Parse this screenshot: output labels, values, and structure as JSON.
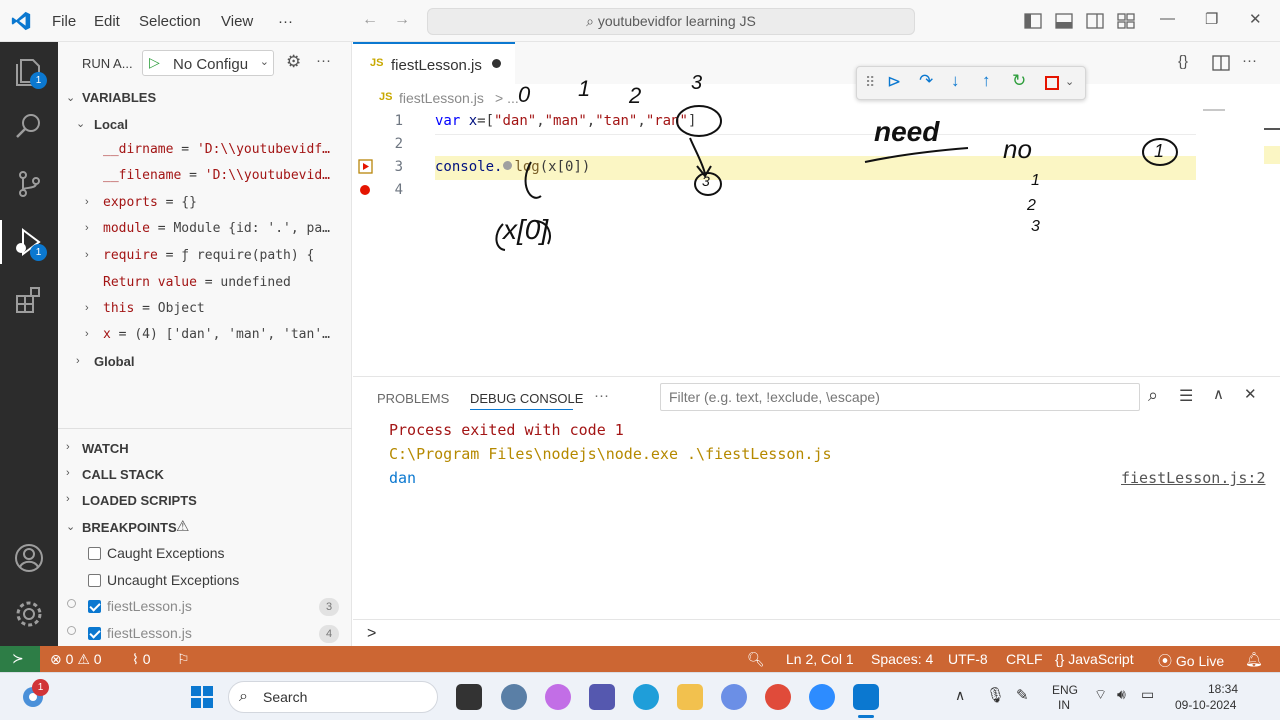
{
  "titlebar": {
    "menu": [
      "File",
      "Edit",
      "Selection",
      "View",
      "···"
    ],
    "search": "youtubevidfor learning JS"
  },
  "activity": {
    "explorer_badge": "1",
    "debug_badge": "1"
  },
  "sidebar": {
    "run_label": "RUN A...",
    "config": "No Configu",
    "variables_title": "VARIABLES",
    "local_title": "Local",
    "vars": [
      {
        "name": "__dirname",
        "value": "'D:\\\\youtubevidf…"
      },
      {
        "name": "__filename",
        "value": "'D:\\\\youtubevid…"
      },
      {
        "name": "exports",
        "value": "{}"
      },
      {
        "name": "module",
        "value": "Module {id: '.', pa…"
      },
      {
        "name": "require",
        "value": "ƒ require(path) {"
      },
      {
        "name": "Return value",
        "value": "undefined"
      },
      {
        "name": "this",
        "value": "Object"
      },
      {
        "name": "x",
        "value": "(4) ['dan', 'man', 'tan'…"
      }
    ],
    "global_title": "Global",
    "watch": "WATCH",
    "callstack": "CALL STACK",
    "loaded": "LOADED SCRIPTS",
    "breakpoints": "BREAKPOINTS",
    "bp_items": [
      {
        "label": "Caught Exceptions",
        "checked": false
      },
      {
        "label": "Uncaught Exceptions",
        "checked": false
      },
      {
        "label": "fiestLesson.js",
        "checked": true,
        "count": "3"
      },
      {
        "label": "fiestLesson.js",
        "checked": true,
        "count": "4"
      }
    ]
  },
  "editor": {
    "tab_name": "fiestLesson.js",
    "breadcrumb_file": "fiestLesson.js",
    "breadcrumb_more": "> ...",
    "lines": [
      "1",
      "2",
      "3",
      "4"
    ],
    "code": {
      "l1_kw": "var",
      "l1_id": "x",
      "l1_eq": "=[",
      "l1_s1": "\"dan\"",
      "l1_s2": "\"man\"",
      "l1_s3": "\"tan\"",
      "l1_s4": "\"ran\"",
      "l1_end": "]",
      "l3_obj": "console.",
      "l3_fn": "log",
      "l3_rest": "(x[0])"
    },
    "annotations": {
      "n0": "0",
      "n1": "1",
      "n2": "2",
      "n3": "3",
      "need": "need",
      "no": "no",
      "circle1": "1",
      "col1": "1",
      "col2": "2",
      "col3": "3",
      "arrow_target": "3",
      "xexpr": "x[0]"
    }
  },
  "panel": {
    "tabs": [
      "PROBLEMS",
      "DEBUG CONSOLE",
      "···"
    ],
    "filter_placeholder": "Filter (e.g. text, !exclude, \\escape)",
    "console": [
      {
        "text": "Process exited with code 1",
        "color": "#a31515"
      },
      {
        "text": "C:\\Program Files\\nodejs\\node.exe .\\fiestLesson.js",
        "color": "#b58900"
      },
      {
        "text": "dan",
        "color": "#0b78d0"
      }
    ],
    "source_link": "fiestLesson.js:2",
    "prompt": ">"
  },
  "status": {
    "errors": "0",
    "warnings": "0",
    "ports": "0",
    "position": "Ln 2, Col 1",
    "spaces": "Spaces: 4",
    "encoding": "UTF-8",
    "eol": "CRLF",
    "language": "JavaScript",
    "golive": "Go Live"
  },
  "taskbar": {
    "search": "Search",
    "lang1": "ENG",
    "lang2": "IN",
    "time": "18:34",
    "date": "09-10-2024",
    "notif_badge": "1"
  }
}
